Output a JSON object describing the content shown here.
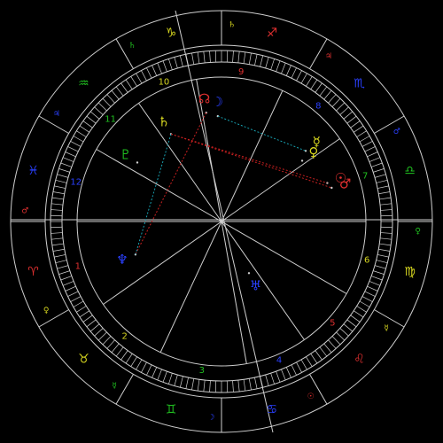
{
  "colors": {
    "background": "#000000",
    "ring": "#cfcfcf",
    "fire": "#e03030",
    "earth": "#d8d820",
    "air": "#20c020",
    "water": "#2a40ff",
    "aspect_red": "#c82020",
    "aspect_blue": "#18a0b0"
  },
  "zodiac_signs": [
    {
      "glyph": "♈",
      "name": "aries",
      "color": "#e03030"
    },
    {
      "glyph": "♉",
      "name": "taurus",
      "color": "#d8d820"
    },
    {
      "glyph": "♊",
      "name": "gemini",
      "color": "#20c020"
    },
    {
      "glyph": "♋",
      "name": "cancer",
      "color": "#2a40ff"
    },
    {
      "glyph": "♌",
      "name": "leo",
      "color": "#e03030"
    },
    {
      "glyph": "♍",
      "name": "virgo",
      "color": "#d8d820"
    },
    {
      "glyph": "♎",
      "name": "libra",
      "color": "#20c020"
    },
    {
      "glyph": "♏",
      "name": "scorpio",
      "color": "#2a40ff"
    },
    {
      "glyph": "♐",
      "name": "sagittarius",
      "color": "#e03030"
    },
    {
      "glyph": "♑",
      "name": "capricorn",
      "color": "#d8d820"
    },
    {
      "glyph": "♒",
      "name": "aquarius",
      "color": "#20c020"
    },
    {
      "glyph": "♓",
      "name": "pisces",
      "color": "#2a40ff"
    }
  ],
  "house_numbers": [
    {
      "label": "1",
      "color": "#e03030"
    },
    {
      "label": "2",
      "color": "#d8d820"
    },
    {
      "label": "3",
      "color": "#20c020"
    },
    {
      "label": "4",
      "color": "#2a40ff"
    },
    {
      "label": "5",
      "color": "#e03030"
    },
    {
      "label": "6",
      "color": "#d8d820"
    },
    {
      "label": "7",
      "color": "#20c020"
    },
    {
      "label": "8",
      "color": "#2a40ff"
    },
    {
      "label": "9",
      "color": "#e03030"
    },
    {
      "label": "10",
      "color": "#d8d820"
    },
    {
      "label": "11",
      "color": "#20c020"
    },
    {
      "label": "12",
      "color": "#2a40ff"
    }
  ],
  "rulers": [
    {
      "glyph": "♂",
      "color": "#e03030"
    },
    {
      "glyph": "♀",
      "color": "#d8d820"
    },
    {
      "glyph": "☿",
      "color": "#20c020"
    },
    {
      "glyph": "☽",
      "color": "#2a40ff"
    },
    {
      "glyph": "☉",
      "color": "#e03030"
    },
    {
      "glyph": "☿",
      "color": "#d8d820"
    },
    {
      "glyph": "♀",
      "color": "#20c020"
    },
    {
      "glyph": "♂",
      "color": "#2a40ff"
    },
    {
      "glyph": "♃",
      "color": "#e03030"
    },
    {
      "glyph": "♄",
      "color": "#d8d820"
    },
    {
      "glyph": "♄",
      "color": "#20c020"
    },
    {
      "glyph": "♃",
      "color": "#2a40ff"
    }
  ],
  "planets": [
    {
      "glyph": "☉",
      "name": "sun",
      "color": "#e03030"
    },
    {
      "glyph": "♂",
      "name": "mars",
      "color": "#e03030"
    },
    {
      "glyph": "☿",
      "name": "mercury",
      "color": "#d8d820"
    },
    {
      "glyph": "♀",
      "name": "venus",
      "color": "#d8d820"
    },
    {
      "glyph": "☊",
      "name": "north-node",
      "color": "#e03030"
    },
    {
      "glyph": "☽",
      "name": "moon",
      "color": "#2a40ff"
    },
    {
      "glyph": "♄",
      "name": "saturn",
      "color": "#d8d820"
    },
    {
      "glyph": "♅",
      "name": "uranus",
      "color": "#2a40ff"
    },
    {
      "glyph": "♆",
      "name": "neptune",
      "color": "#2a40ff"
    },
    {
      "glyph": "♇",
      "name": "pluto",
      "color": "#20c020"
    }
  ]
}
